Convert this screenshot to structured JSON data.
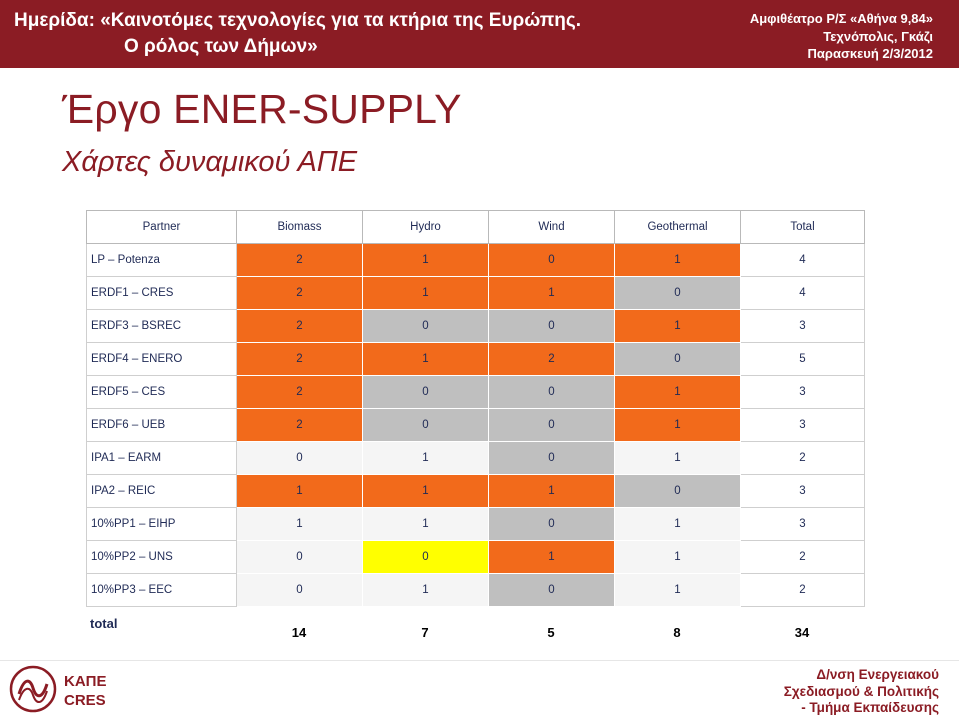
{
  "header": {
    "line1": "Ημερίδα: «Καινοτόμες τεχνολογίες για τα κτήρια της Ευρώπης.",
    "line2": "Ο ρόλος των Δήμων»",
    "venue": "Αμφιθέατρο Ρ/Σ «Αθήνα 9,84»",
    "place": "Τεχνόπολις, Γκάζι",
    "date": "Παρασκευή 2/3/2012"
  },
  "title": "Έργο ENER-SUPPLY",
  "subtitle": "Χάρτες δυναμικού ΑΠΕ",
  "table": {
    "columns": [
      "Partner",
      "Biomass",
      "Hydro",
      "Wind",
      "Geothermal",
      "Total"
    ],
    "rows": [
      {
        "partner": "LP – Potenza",
        "values": [
          "2",
          "1",
          "0",
          "1"
        ],
        "colors": [
          "o",
          "o",
          "o",
          "o"
        ],
        "total": "4"
      },
      {
        "partner": "ERDF1 – CRES",
        "values": [
          "2",
          "1",
          "1",
          "0"
        ],
        "colors": [
          "o",
          "o",
          "o",
          "g"
        ],
        "total": "4"
      },
      {
        "partner": "ERDF3 – BSREC",
        "values": [
          "2",
          "0",
          "0",
          "1"
        ],
        "colors": [
          "o",
          "g",
          "g",
          "o"
        ],
        "total": "3"
      },
      {
        "partner": "ERDF4 – ENERO",
        "values": [
          "2",
          "1",
          "2",
          "0"
        ],
        "colors": [
          "o",
          "o",
          "o",
          "g"
        ],
        "total": "5"
      },
      {
        "partner": "ERDF5 – CES",
        "values": [
          "2",
          "0",
          "0",
          "1"
        ],
        "colors": [
          "o",
          "g",
          "g",
          "o"
        ],
        "total": "3"
      },
      {
        "partner": "ERDF6 – UEB",
        "values": [
          "2",
          "0",
          "0",
          "1"
        ],
        "colors": [
          "o",
          "g",
          "g",
          "o"
        ],
        "total": "3"
      },
      {
        "partner": "IPA1 – EARM",
        "values": [
          "0",
          "1",
          "0",
          "1"
        ],
        "colors": [
          "w",
          "w",
          "g",
          "w"
        ],
        "total": "2"
      },
      {
        "partner": "IPA2 – REIC",
        "values": [
          "1",
          "1",
          "1",
          "0"
        ],
        "colors": [
          "o",
          "o",
          "o",
          "g"
        ],
        "total": "3"
      },
      {
        "partner": "10%PP1 – EIHP",
        "values": [
          "1",
          "1",
          "0",
          "1"
        ],
        "colors": [
          "w",
          "w",
          "g",
          "w"
        ],
        "total": "3"
      },
      {
        "partner": "10%PP2 – UNS",
        "values": [
          "0",
          "0",
          "1",
          "1"
        ],
        "colors": [
          "w",
          "y",
          "o",
          "w"
        ],
        "total": "2"
      },
      {
        "partner": "10%PP3 – EEC",
        "values": [
          "0",
          "1",
          "0",
          "1"
        ],
        "colors": [
          "w",
          "w",
          "g",
          "w"
        ],
        "total": "2"
      }
    ],
    "totals_label": "total",
    "totals": [
      "14",
      "7",
      "5",
      "8",
      "34"
    ]
  },
  "footer": {
    "logo_line1": "ΚΑΠΕ",
    "logo_line2": "CRES",
    "right_line1": "Δ/νση Ενεργειακού",
    "right_line2": "Σχεδιασμού & Πολιτικής",
    "right_line3": "- Τμήμα Εκπαίδευσης"
  },
  "colors": {
    "brand": "#8b1c24",
    "orange": "#f26a1b",
    "gray": "#bfbfbf",
    "light": "#f5f5f5",
    "yellow": "#ffff00"
  }
}
